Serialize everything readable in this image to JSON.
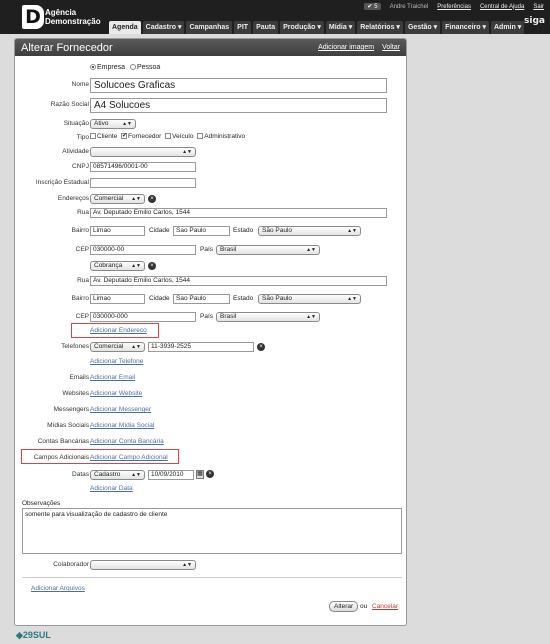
{
  "app": {
    "logo_letter": "D",
    "logo_line1": "Agência",
    "logo_line2": "Demonstração",
    "brand": "siga"
  },
  "userbar": {
    "user": "Andre Traichel",
    "notifications": "5",
    "prefs": "Preferências",
    "help": "Central de Ajuda",
    "logout": "Sair"
  },
  "nav": [
    "Agenda",
    "Cadastro ▾",
    "Campanhas",
    "PIT",
    "Pauta",
    "Produção ▾",
    "Mídia ▾",
    "Relatórios ▾",
    "Gestão ▾",
    "Financeiro ▾",
    "Admin ▾"
  ],
  "panel": {
    "title": "Alterar Fornecedor",
    "add_image": "Adicionar imagem",
    "back": "Voltar"
  },
  "form": {
    "tipo_empresa": "Empresa",
    "tipo_pessoa": "Pessoa",
    "nome_label": "Nome",
    "nome": "Solucoes Graficas",
    "razao_label": "Razão Social",
    "razao": "A4 Solucoes",
    "situacao_label": "Situação",
    "situacao": "Ativo",
    "tipo_label": "Tipo",
    "tipo_cliente": "Cliente",
    "tipo_fornecedor": "Fornecedor",
    "tipo_veiculo": "Veículo",
    "tipo_admin": "Administrativo",
    "atividade_label": "Atividade",
    "atividade": "",
    "cnpj_label": "CNPJ",
    "cnpj": "08571496/0001-00",
    "ie_label": "Inscrição Estadual",
    "ie": "",
    "enderecos_label": "Endereços",
    "rua_label": "Rua",
    "bairro_label": "Bairro",
    "cidade_label": "Cidade",
    "estado_label": "Estado",
    "cep_label": "CEP",
    "pais_label": "País",
    "addr1": {
      "type": "Comercial",
      "rua": "Av. Deputado Emilio Carlos, 1544",
      "bairro": "Limao",
      "cidade": "Sao Paulo",
      "estado": "São Paulo",
      "cep": "030000-00",
      "pais": "Brasil"
    },
    "addr2": {
      "type": "Cobrança",
      "rua": "Av. Deputado Emilio Carlos, 1544",
      "bairro": "Limao",
      "cidade": "Sao Paulo",
      "estado": "São Paulo",
      "cep": "030000-000",
      "pais": "Brasil"
    },
    "add_endereco": "Adicionar Endereco",
    "telefones_label": "Telefones",
    "tel_type": "Comercial",
    "tel": "11-3939-2525",
    "add_telefone": "Adicionar Telefone",
    "emails_label": "Emails",
    "add_email": "Adicionar Email",
    "websites_label": "Websites",
    "add_website": "Adicionar Website",
    "messengers_label": "Messengers",
    "add_messenger": "Adicionar Messenger",
    "midias_label": "Mídias Sociais",
    "add_midia": "Adicionar Mídia Social",
    "contas_label": "Contas Bancárias",
    "add_conta": "Adicionar Conta Bancária",
    "campos_label": "Campos Adicionais",
    "add_campo": "Adicionar Campo Adicional",
    "datas_label": "Datas",
    "data_type": "Cadastro",
    "data_value": "10/09/2010",
    "add_data": "Adicionar Data",
    "obs_label": "Observações",
    "obs": "somente para visualização de cadastro de cliente",
    "colab_label": "Colaborador",
    "colab": "",
    "add_arquivos": "Adicionar Arquivos",
    "submit": "Alterar",
    "or": "ou",
    "cancel": "Cancelar"
  },
  "footer": "◆29SUL"
}
